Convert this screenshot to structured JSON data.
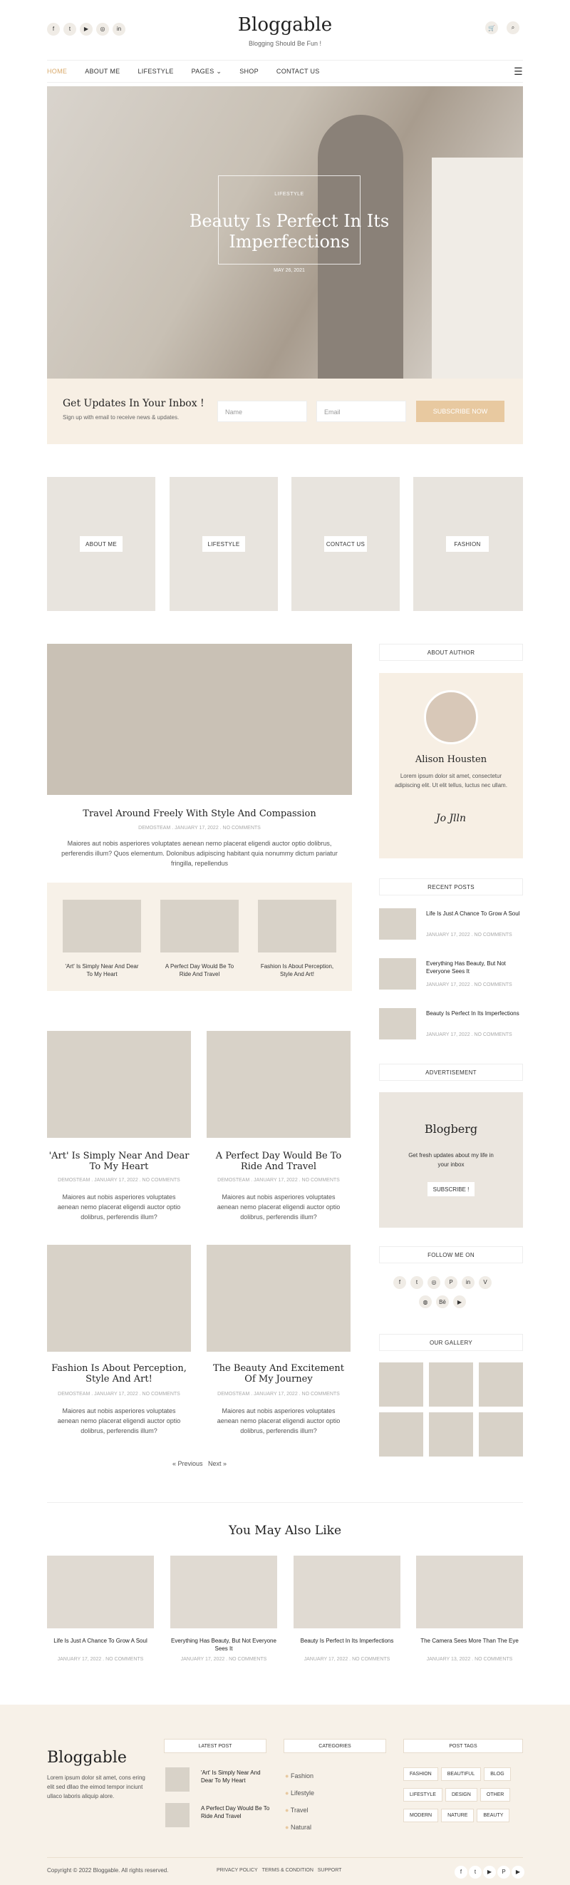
{
  "header": {
    "logo": "Bloggable",
    "tagline": "Blogging Should Be Fun !",
    "cart_count": "0",
    "social": [
      "facebook-icon",
      "twitter-icon",
      "youtube-icon",
      "instagram-icon",
      "linkedin-icon"
    ]
  },
  "nav": {
    "items": [
      "HOME",
      "ABOUT ME",
      "LIFESTYLE",
      "PAGES",
      "SHOP",
      "CONTACT US"
    ]
  },
  "hero": {
    "category": "LIFESTYLE",
    "title": "Beauty Is Perfect In Its Imperfections",
    "date": "MAY 26, 2021"
  },
  "subscribe": {
    "title": "Get Updates In Your Inbox !",
    "subtitle": "Sign up with email to receive news & updates.",
    "name_placeholder": "Name",
    "email_placeholder": "Email",
    "button": "SUBSCRIBE NOW"
  },
  "categories": [
    "ABOUT ME",
    "LIFESTYLE",
    "CONTACT US",
    "FASHION"
  ],
  "featured": {
    "title": "Travel Around Freely With Style And Compassion",
    "meta": "DEMOSTEAM . JANUARY 17, 2022 . NO COMMENTS",
    "excerpt": "Maiores aut nobis asperiores voluptates aenean nemo placerat eligendi auctor optio dolibrus, perferendis illum? Quos elementum. Dolonibus adipiscing habitant quia nonummy dictum pariatur fringilla, repellendus"
  },
  "mini_posts": [
    "'Art' Is Simply Near And Dear To My Heart",
    "A Perfect Day Would Be To Ride And Travel",
    "Fashion Is About Perception, Style And Art!"
  ],
  "posts": [
    {
      "title": "'Art' Is Simply Near And Dear To My Heart",
      "meta": "DEMOSTEAM . JANUARY 17, 2022 . NO COMMENTS",
      "excerpt": "Maiores aut nobis asperiores voluptates aenean nemo placerat eligendi auctor optio dolibrus, perferendis illum?"
    },
    {
      "title": "A Perfect Day Would Be To Ride And Travel",
      "meta": "DEMOSTEAM . JANUARY 17, 2022 . NO COMMENTS",
      "excerpt": "Maiores aut nobis asperiores voluptates aenean nemo placerat eligendi auctor optio dolibrus, perferendis illum?"
    },
    {
      "title": "Fashion Is About Perception, Style And Art!",
      "meta": "DEMOSTEAM . JANUARY 17, 2022 . NO COMMENTS",
      "excerpt": "Maiores aut nobis asperiores voluptates aenean nemo placerat eligendi auctor optio dolibrus, perferendis illum?"
    },
    {
      "title": "The Beauty And Excitement Of My Journey",
      "meta": "DEMOSTEAM . JANUARY 17, 2022 . NO COMMENTS",
      "excerpt": "Maiores aut nobis asperiores voluptates aenean nemo placerat eligendi auctor optio dolibrus, perferendis illum?"
    }
  ],
  "pagination": {
    "prev": "« Previous",
    "next": "Next »"
  },
  "sidebar": {
    "about_heading": "ABOUT AUTHOR",
    "author_name": "Alison Housten",
    "author_bio": "Lorem ipsum dolor sit amet, consectetur adipiscing elit. Ut elit tellus, luctus nec ullam.",
    "signature": "Jo Jlln",
    "recent_heading": "RECENT POSTS",
    "recent": [
      {
        "title": "Life Is Just A Chance To Grow A Soul",
        "meta": "JANUARY 17, 2022 . NO COMMENTS"
      },
      {
        "title": "Everything Has Beauty, But Not Everyone Sees It",
        "meta": "JANUARY 17, 2022 . NO COMMENTS"
      },
      {
        "title": "Beauty Is Perfect In Its Imperfections",
        "meta": "JANUARY 17, 2022 . NO COMMENTS"
      }
    ],
    "ad_heading": "ADVERTISEMENT",
    "ad_brand": "Blogberg",
    "ad_text": "Get fresh updates about my life in your inbox",
    "ad_button": "SUBSCRIBE !",
    "follow_heading": "FOLLOW ME ON",
    "follow_icons": [
      "facebook-icon",
      "twitter-icon",
      "instagram-icon",
      "pinterest-icon",
      "linkedin-icon",
      "vimeo-icon",
      "dribbble-icon",
      "behance-icon",
      "youtube-icon"
    ],
    "behance_text": "Bē",
    "gallery_heading": "OUR GALLERY"
  },
  "you_may": {
    "heading": "You May Also Like",
    "items": [
      {
        "title": "Life Is Just A Chance To Grow A Soul",
        "meta": "JANUARY 17, 2022 . NO COMMENTS"
      },
      {
        "title": "Everything Has Beauty, But Not Everyone Sees It",
        "meta": "JANUARY 17, 2022 . NO COMMENTS"
      },
      {
        "title": "Beauty Is Perfect In Its Imperfections",
        "meta": "JANUARY 17, 2022 . NO COMMENTS"
      },
      {
        "title": "The Camera Sees More Than The Eye",
        "meta": "JANUARY 13, 2022 . NO COMMENTS"
      }
    ]
  },
  "footer": {
    "logo": "Bloggable",
    "about": "Lorem ipsum dolor sit amet, cons ering elit sed dllao the eimod tempor inciunt ullaco laboris aliquip alore.",
    "latest_heading": "LATEST POST",
    "latest": [
      "'Art' Is Simply Near And Dear To My Heart",
      "A Perfect Day Would Be To Ride And Travel"
    ],
    "categories_heading": "CATEGORIES",
    "categories": [
      "Fashion",
      "Lifestyle",
      "Travel",
      "Natural"
    ],
    "tags_heading": "POST TAGS",
    "tags": [
      "FASHION",
      "BEAUTIFUL",
      "BLOG",
      "LIFESTYLE",
      "DESIGN",
      "OTHER",
      "MODERN",
      "NATURE",
      "BEAUTY"
    ],
    "copyright": "Copyright © 2022 Bloggable. All rights reserved.",
    "links": [
      "PRIVACY POLICY",
      "TERMS & CONDITION",
      "SUPPORT"
    ],
    "social": [
      "facebook-icon",
      "twitter-icon",
      "youtube-icon",
      "pinterest-icon",
      "youtube-icon"
    ]
  },
  "colors": {
    "accent": "#e8c9a0",
    "beige": "#f7efe4",
    "active": "#d9a96a"
  }
}
